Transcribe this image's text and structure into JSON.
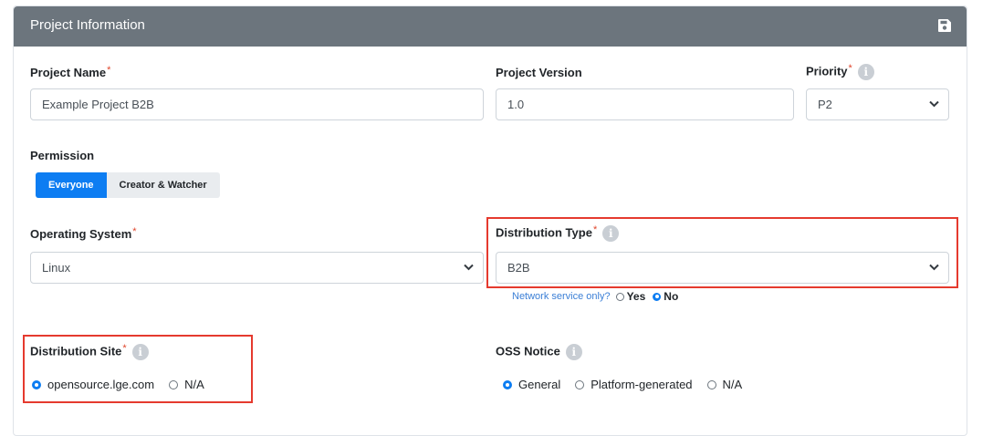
{
  "header": {
    "title": "Project Information",
    "save_icon": "save-icon"
  },
  "project_name": {
    "label": "Project Name",
    "required": "*",
    "value": "Example Project B2B"
  },
  "project_version": {
    "label": "Project Version",
    "value": "1.0"
  },
  "priority": {
    "label": "Priority",
    "required": "*",
    "info_icon": "i",
    "value": "P2"
  },
  "permission": {
    "label": "Permission",
    "options": [
      "Everyone",
      "Creator & Watcher"
    ],
    "selected": "Everyone"
  },
  "operating_system": {
    "label": "Operating System",
    "required": "*",
    "value": "Linux"
  },
  "distribution_type": {
    "label": "Distribution Type",
    "required": "*",
    "info_icon": "i",
    "value": "B2B",
    "network_question": "Network service only?",
    "network_options": [
      "Yes",
      "No"
    ],
    "network_selected": "No"
  },
  "distribution_site": {
    "label": "Distribution Site",
    "required": "*",
    "info_icon": "i",
    "options": [
      "opensource.lge.com",
      "N/A"
    ],
    "selected": "opensource.lge.com"
  },
  "oss_notice": {
    "label": "OSS Notice",
    "info_icon": "i",
    "options": [
      "General",
      "Platform-generated",
      "N/A"
    ],
    "selected": "General"
  },
  "colors": {
    "header_bg": "#6c757d",
    "primary": "#0d7df2",
    "required": "#e0452b",
    "highlight": "#e53a2e",
    "link": "#3b7fd6"
  }
}
